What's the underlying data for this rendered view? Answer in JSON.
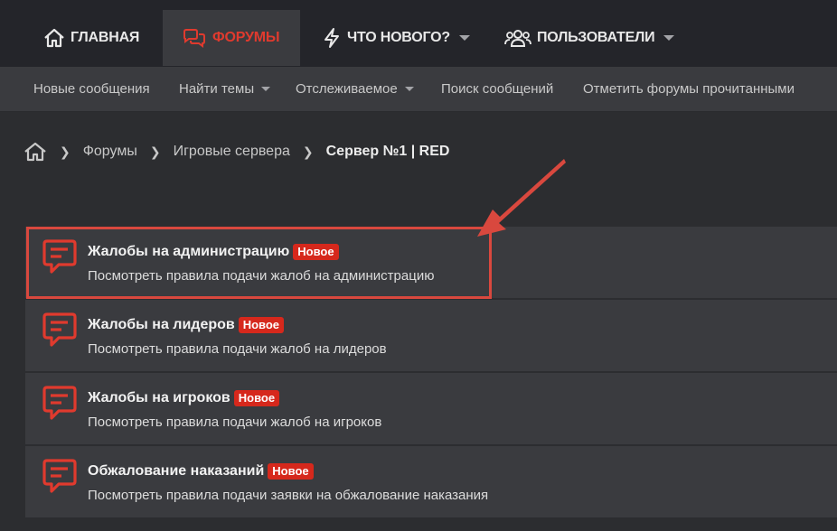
{
  "topnav": {
    "tabs": [
      {
        "label": "ГЛАВНАЯ",
        "icon": "home-icon",
        "active": false,
        "dropdown": false
      },
      {
        "label": "ФОРУМЫ",
        "icon": "comments-icon",
        "active": true,
        "dropdown": false
      },
      {
        "label": "ЧТО НОВОГО?",
        "icon": "bolt-icon",
        "active": false,
        "dropdown": true
      },
      {
        "label": "ПОЛЬЗОВАТЕЛИ",
        "icon": "users-icon",
        "active": false,
        "dropdown": true
      }
    ]
  },
  "subnav": {
    "items": [
      {
        "label": "Новые сообщения",
        "dropdown": false
      },
      {
        "label": "Найти темы",
        "dropdown": true
      },
      {
        "label": "Отслеживаемое",
        "dropdown": true
      },
      {
        "label": "Поиск сообщений",
        "dropdown": false
      },
      {
        "label": "Отметить форумы прочитанными",
        "dropdown": false
      }
    ]
  },
  "breadcrumb": {
    "home_icon": "home-icon",
    "items": [
      "Форумы",
      "Игровые сервера"
    ],
    "current": "Сервер №1 | RED"
  },
  "forums": [
    {
      "title": "Жалобы на администрацию",
      "badge": "Новое",
      "description": "Посмотреть правила подачи жалоб на администрацию"
    },
    {
      "title": "Жалобы на лидеров",
      "badge": "Новое",
      "description": "Посмотреть правила подачи жалоб на лидеров"
    },
    {
      "title": "Жалобы на игроков",
      "badge": "Новое",
      "description": "Посмотреть правила подачи жалоб на игроков"
    },
    {
      "title": "Обжалование наказаний",
      "badge": "Новое",
      "description": "Посмотреть правила подачи заявки на обжалование наказания"
    }
  ],
  "colors": {
    "accent": "#e03a2e",
    "badge": "#d6281c",
    "annotation": "#d9483e",
    "background": "#2c2d30",
    "panel": "#3a3b3f"
  }
}
